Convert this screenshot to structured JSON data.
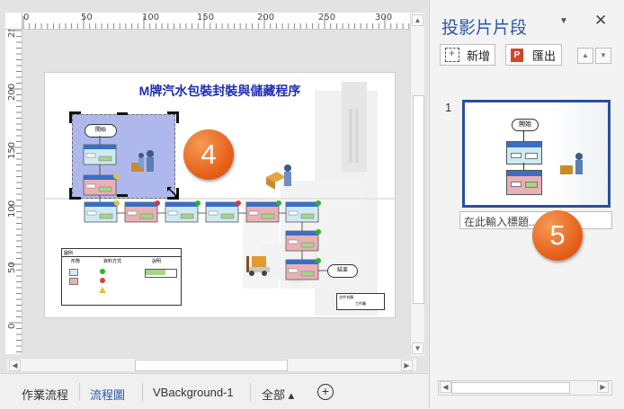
{
  "ruler": {
    "top_ticks": [
      "0",
      "50",
      "100",
      "150",
      "200",
      "250",
      "300"
    ],
    "left_ticks": [
      "250",
      "200",
      "150",
      "100",
      "50",
      "0"
    ]
  },
  "page": {
    "title": "M牌汽水包裝封裝與儲藏程序",
    "start_label": "開始",
    "end_label": "結束",
    "legend_title": "圖例",
    "legend_col1": "形態",
    "legend_col2": "資料方式",
    "legend_col3": "說明",
    "info_box_text": "文件名稱",
    "info_box_value": "工作圖"
  },
  "badges": {
    "left": "4",
    "right": "5"
  },
  "tabs": [
    {
      "label": "作業流程",
      "active": false
    },
    {
      "label": "流程圖",
      "active": true
    },
    {
      "label": "VBackground-1",
      "active": false
    },
    {
      "label": "全部 ▴",
      "active": false
    }
  ],
  "pane": {
    "title": "投影片片段",
    "new_label": "新增",
    "export_label": "匯出",
    "slide_number": "1",
    "thumb_start": "開始",
    "title_placeholder": "在此輸入標題..."
  },
  "colors": {
    "accent": "#2a4f9a",
    "badge": "#e8661f",
    "selection": "#aeb8ec"
  },
  "icons": [
    "dropdown-icon",
    "close-icon",
    "new-icon",
    "export-icon",
    "up-arrow-icon",
    "down-arrow-icon",
    "add-tab-icon"
  ]
}
